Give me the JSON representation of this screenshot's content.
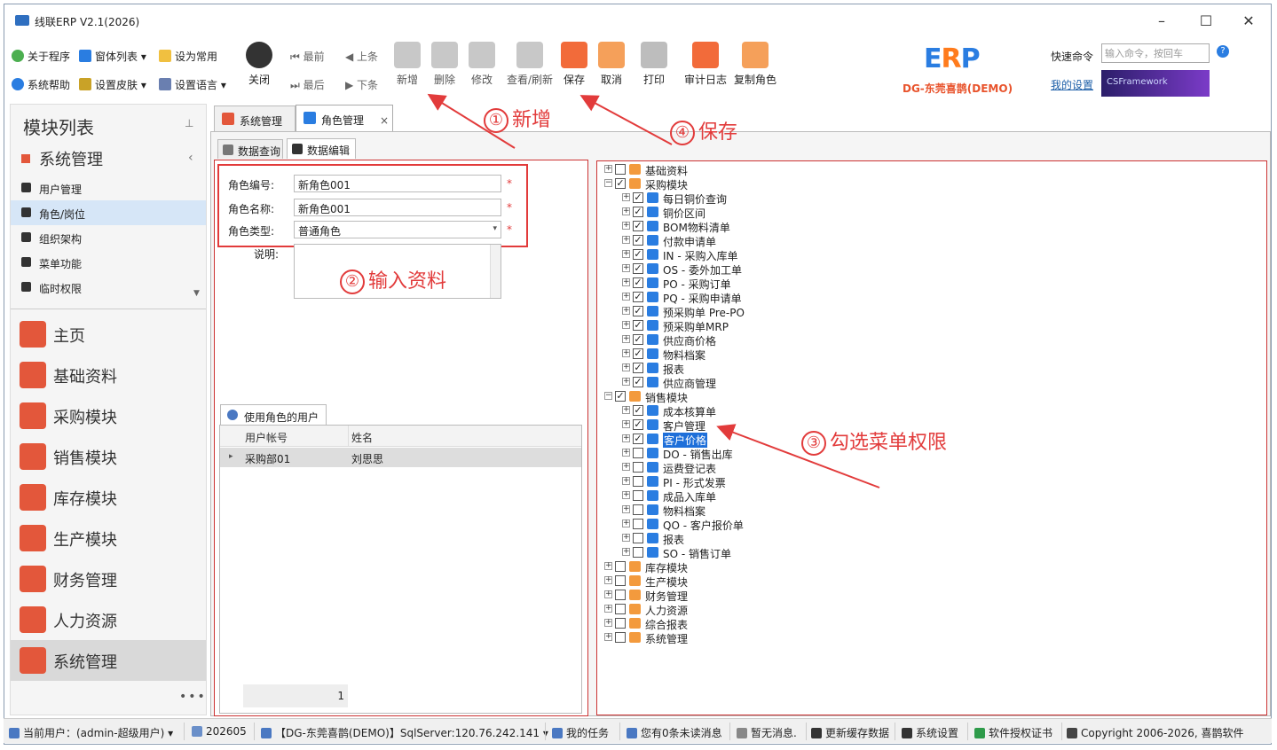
{
  "window": {
    "title": "线联ERP V2.1(2026)"
  },
  "ribbon": {
    "about": "关于程序",
    "window_list": "窗体列表",
    "set_common": "设为常用",
    "help": "系统帮助",
    "skin": "设置皮肤",
    "language": "设置语言",
    "close": "关闭",
    "first": "最前",
    "prev": "上条",
    "last": "最后",
    "next": "下条",
    "add": "新增",
    "delete": "删除",
    "edit": "修改",
    "view_refresh": "查看/刷新",
    "save": "保存",
    "cancel": "取消",
    "print": "打印",
    "audit_log": "审计日志",
    "copy_role": "复制角色",
    "brand_erp_1": "E",
    "brand_erp_2": "R",
    "brand_erp_3": "P",
    "company": "DG-东莞喜鹊(DEMO)",
    "quick_cmd": "快速命令",
    "quick_placeholder": "输入命令，按回车",
    "my_settings": "我的设置",
    "csframework": "CSFramework"
  },
  "left": {
    "title": "模块列表",
    "pin": "⊥",
    "section": "系统管理",
    "section_chev": "‹",
    "items": [
      "用户管理",
      "角色/岗位",
      "组织架构",
      "菜单功能",
      "临时权限"
    ],
    "modules": [
      "主页",
      "基础资料",
      "采购模块",
      "销售模块",
      "库存模块",
      "生产模块",
      "财务管理",
      "人力资源",
      "系统管理"
    ],
    "more": "•••"
  },
  "tabs": [
    {
      "label": "系统管理"
    },
    {
      "label": "角色管理",
      "close": "×"
    }
  ],
  "subtabs": [
    "数据查询",
    "数据编辑"
  ],
  "form": {
    "role_no_label": "角色编号:",
    "role_no": "新角色001",
    "role_name_label": "角色名称:",
    "role_name": "新角色001",
    "role_type_label": "角色类型:",
    "role_type": "普通角色",
    "desc_label": "说明:",
    "required": "*"
  },
  "users_grid": {
    "tab": "使用角色的用户",
    "columns": [
      "用户帐号",
      "姓名"
    ],
    "rows": [
      {
        "account": "采购部01",
        "name": "刘思思"
      }
    ],
    "footer_count": "1"
  },
  "tree": [
    {
      "label": "基础资料",
      "level": 0,
      "checked": false,
      "exp": "+"
    },
    {
      "label": "采购模块",
      "level": 0,
      "checked": true,
      "exp": "−"
    },
    {
      "label": "每日铜价查询",
      "level": 1,
      "checked": true
    },
    {
      "label": "铜价区间",
      "level": 1,
      "checked": true
    },
    {
      "label": "BOM物料清单",
      "level": 1,
      "checked": true
    },
    {
      "label": "付款申请单",
      "level": 1,
      "checked": true
    },
    {
      "label": "IN - 采购入库单",
      "level": 1,
      "checked": true
    },
    {
      "label": "OS - 委外加工单",
      "level": 1,
      "checked": true
    },
    {
      "label": "PO - 采购订单",
      "level": 1,
      "checked": true
    },
    {
      "label": "PQ - 采购申请单",
      "level": 1,
      "checked": true
    },
    {
      "label": "预采购单 Pre-PO",
      "level": 1,
      "checked": true
    },
    {
      "label": "预采购单MRP",
      "level": 1,
      "checked": true
    },
    {
      "label": "供应商价格",
      "level": 1,
      "checked": true
    },
    {
      "label": "物料档案",
      "level": 1,
      "checked": true
    },
    {
      "label": "报表",
      "level": 1,
      "checked": true
    },
    {
      "label": "供应商管理",
      "level": 1,
      "checked": true
    },
    {
      "label": "销售模块",
      "level": 0,
      "checked": true,
      "exp": "−"
    },
    {
      "label": "成本核算单",
      "level": 1,
      "checked": true
    },
    {
      "label": "客户管理",
      "level": 1,
      "checked": true
    },
    {
      "label": "客户价格",
      "level": 1,
      "checked": true,
      "highlight": true
    },
    {
      "label": "DO - 销售出库",
      "level": 1,
      "checked": false
    },
    {
      "label": "运费登记表",
      "level": 1,
      "checked": false
    },
    {
      "label": "PI - 形式发票",
      "level": 1,
      "checked": false
    },
    {
      "label": "成品入库单",
      "level": 1,
      "checked": false
    },
    {
      "label": "物料档案",
      "level": 1,
      "checked": false
    },
    {
      "label": "QO - 客户报价单",
      "level": 1,
      "checked": false
    },
    {
      "label": "报表",
      "level": 1,
      "checked": false
    },
    {
      "label": "SO - 销售订单",
      "level": 1,
      "checked": false
    },
    {
      "label": "库存模块",
      "level": 0,
      "checked": false,
      "exp": "+"
    },
    {
      "label": "生产模块",
      "level": 0,
      "checked": false,
      "exp": "+"
    },
    {
      "label": "财务管理",
      "level": 0,
      "checked": false,
      "exp": "+"
    },
    {
      "label": "人力资源",
      "level": 0,
      "checked": false,
      "exp": "+"
    },
    {
      "label": "综合报表",
      "level": 0,
      "checked": false,
      "exp": "+"
    },
    {
      "label": "系统管理",
      "level": 0,
      "checked": false,
      "exp": "+"
    }
  ],
  "annotations": [
    {
      "num": "①",
      "text": "新增"
    },
    {
      "num": "④",
      "text": "保存"
    },
    {
      "num": "②",
      "text": "输入资料"
    },
    {
      "num": "③",
      "text": "勾选菜单权限"
    }
  ],
  "status": {
    "user": "当前用户：(admin-超级用户)",
    "period": "202605",
    "db": "【DG-东莞喜鹊(DEMO)】SqlServer:120.76.242.141",
    "tasks": "我的任务",
    "messages": "您有0条未读消息",
    "notice": "暂无消息.",
    "refresh_cache": "更新缓存数据",
    "settings": "系统设置",
    "license": "软件授权证书",
    "copyright": "Copyright 2006-2026, 喜鹊软件"
  },
  "colors": {
    "accent": "#e3573b",
    "annotation": "#e23b3b",
    "selection": "#1e6fd9",
    "brand_blue": "#2a7de1",
    "brand_orange": "#ff7b1c"
  }
}
